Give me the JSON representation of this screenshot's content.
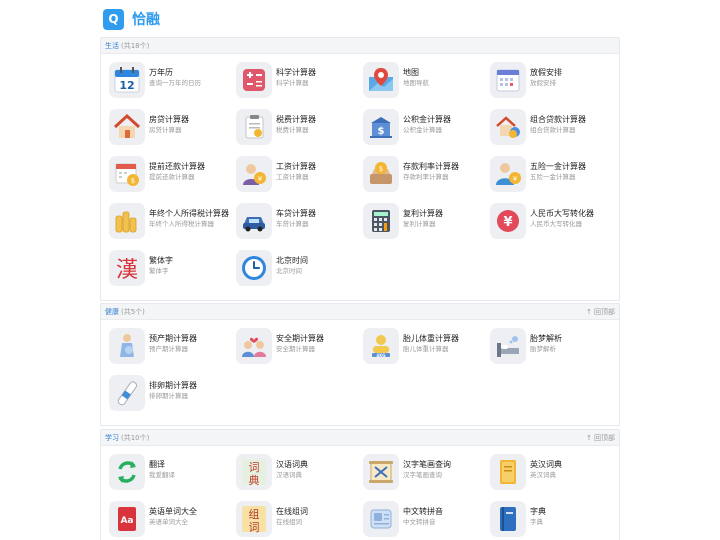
{
  "header": {
    "logo_letter": "Q",
    "brand": "恰融"
  },
  "sections": [
    {
      "title": "生活",
      "count": "(共18个)",
      "collapse": "",
      "items": [
        {
          "name": "万年历",
          "desc": "查询一万年的日历",
          "icon": "calendar-12-icon"
        },
        {
          "name": "科学计算器",
          "desc": "科学计算器",
          "icon": "scientific-calculator-icon"
        },
        {
          "name": "地图",
          "desc": "地图导航",
          "icon": "map-pin-icon"
        },
        {
          "name": "放假安排",
          "desc": "放假安排",
          "icon": "holiday-calendar-icon"
        },
        {
          "name": "房贷计算器",
          "desc": "房贷计算器",
          "icon": "house-icon"
        },
        {
          "name": "税费计算器",
          "desc": "税费计算器",
          "icon": "tax-clipboard-icon"
        },
        {
          "name": "公积金计算器",
          "desc": "公积金计算器",
          "icon": "bank-building-icon"
        },
        {
          "name": "组合贷款计算器",
          "desc": "组合贷款计算器",
          "icon": "house-coins-icon"
        },
        {
          "name": "提前还款计算器",
          "desc": "提前还款计算器",
          "icon": "calendar-coin-icon"
        },
        {
          "name": "工资计算器",
          "desc": "工资计算器",
          "icon": "salary-person-icon"
        },
        {
          "name": "存款利率计算器",
          "desc": "存款利率计算器",
          "icon": "deposit-box-icon"
        },
        {
          "name": "五险一金计算器",
          "desc": "五险一金计算器",
          "icon": "insurance-person-icon"
        },
        {
          "name": "年终个人所得税计算器",
          "desc": "年终个人所得税计算器",
          "icon": "coin-stack-icon"
        },
        {
          "name": "车贷计算器",
          "desc": "车贷计算器",
          "icon": "car-icon"
        },
        {
          "name": "复利计算器",
          "desc": "复利计算器",
          "icon": "building-calculator-icon"
        },
        {
          "name": "人民币大写转化器",
          "desc": "人民币大写转化器",
          "icon": "yuan-coin-icon"
        },
        {
          "name": "繁体字",
          "desc": "繁体字",
          "icon": "han-character-icon",
          "glyph": "漢"
        },
        {
          "name": "北京时间",
          "desc": "北京时间",
          "icon": "clock-icon"
        }
      ]
    },
    {
      "title": "健康",
      "count": "(共5个)",
      "collapse": "回顶部",
      "items": [
        {
          "name": "预产期计算器",
          "desc": "预产期计算器",
          "icon": "pregnancy-icon"
        },
        {
          "name": "安全期计算器",
          "desc": "安全期计算器",
          "icon": "couple-heart-icon"
        },
        {
          "name": "胎儿体重计算器",
          "desc": "胎儿体重计算器",
          "icon": "baby-scale-icon",
          "label": "4KG"
        },
        {
          "name": "胎梦解析",
          "desc": "胎梦解析",
          "icon": "bed-dream-icon"
        },
        {
          "name": "排卵期计算器",
          "desc": "排卵期计算器",
          "icon": "ovulation-test-icon"
        }
      ]
    },
    {
      "title": "学习",
      "count": "(共10个)",
      "collapse": "回顶部",
      "items": [
        {
          "name": "翻译",
          "desc": "我爱翻译",
          "icon": "translate-arrows-icon"
        },
        {
          "name": "汉语词典",
          "desc": "汉语词典",
          "icon": "chinese-dictionary-icon",
          "glyph": "词",
          "glyph2": "典"
        },
        {
          "name": "汉字笔画查询",
          "desc": "汉字笔画查询",
          "icon": "stroke-scroll-icon"
        },
        {
          "name": "英汉词典",
          "desc": "英汉词典",
          "icon": "english-dictionary-icon"
        },
        {
          "name": "英语单词大全",
          "desc": "英语单词大全",
          "icon": "aa-book-icon",
          "glyph": "Aa"
        },
        {
          "name": "在线组词",
          "desc": "在线组词",
          "icon": "word-group-icon",
          "glyph": "组",
          "glyph2": "词"
        },
        {
          "name": "中文转拼音",
          "desc": "中文转拼音",
          "icon": "pinyin-card-icon"
        },
        {
          "name": "字典",
          "desc": "字典",
          "icon": "blue-book-icon"
        }
      ]
    }
  ]
}
